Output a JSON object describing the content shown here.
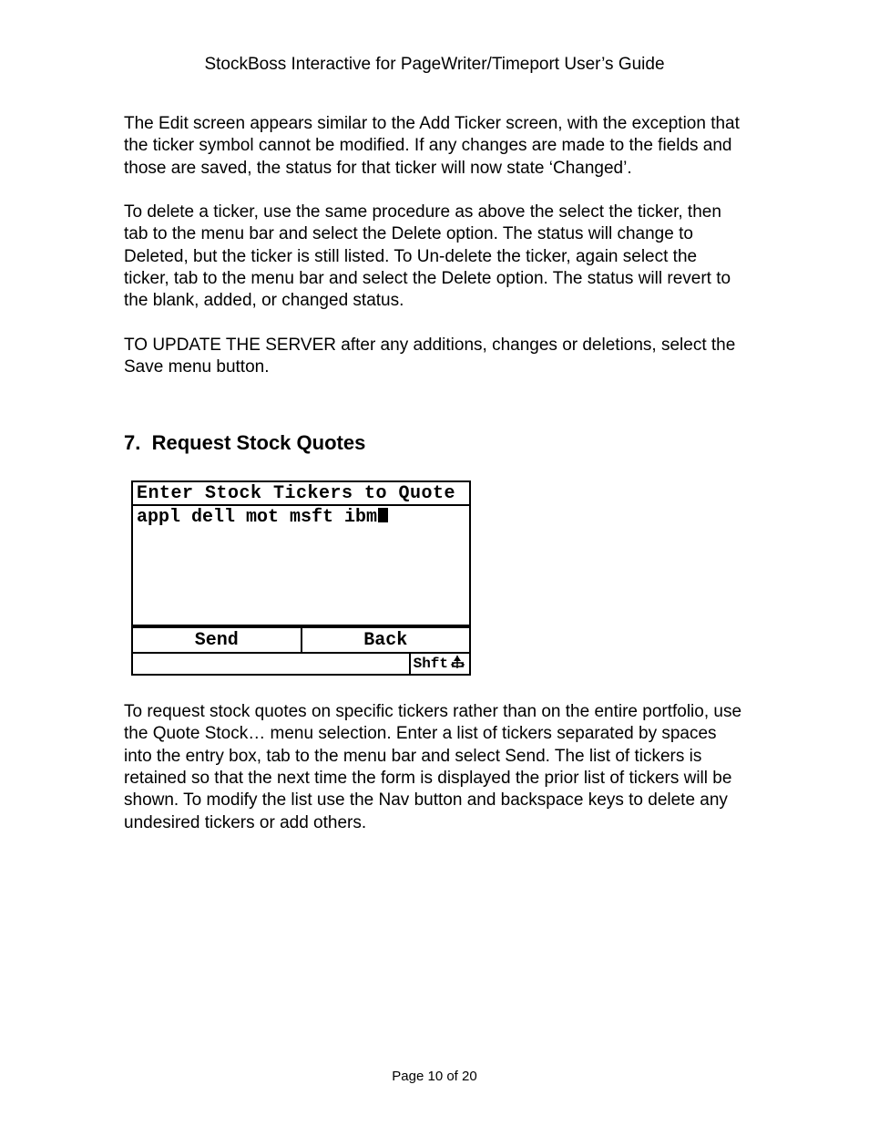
{
  "header": "StockBoss Interactive for PageWriter/Timeport User’s Guide",
  "paragraphs": {
    "p1": "The Edit screen appears similar to the Add Ticker screen, with the exception that the ticker symbol cannot be modified.  If any changes are made to the fields and those are saved, the status for that ticker will now state ‘Changed’.",
    "p2": "To delete a ticker, use the same procedure as above the select the ticker, then tab to the menu bar and select the Delete option.  The status will change to Deleted, but the ticker is still listed.  To Un-delete the ticker, again select the ticker, tab to the menu bar and select the Delete option.  The status will revert to the blank, added, or changed status.",
    "p3": "TO UPDATE THE SERVER after any additions, changes or deletions, select the Save menu button.",
    "p4": "To request stock quotes on specific tickers rather than on the entire portfolio, use the Quote Stock… menu selection.  Enter a list of tickers separated by spaces into the entry box, tab to the menu bar and select Send.  The list of tickers is retained so that the next time the form is displayed the prior list of tickers will be shown.  To modify the list use the Nav button and backspace keys to delete any undesired tickers or add others."
  },
  "section": {
    "number": "7.",
    "title": "Request Stock Quotes"
  },
  "device": {
    "title": "Enter Stock Tickers to Quote",
    "input_value": "appl dell mot msft ibm",
    "buttons": {
      "send": "Send",
      "back": "Back"
    },
    "status": {
      "shft": "Shft"
    }
  },
  "footer": "Page 10 of 20"
}
